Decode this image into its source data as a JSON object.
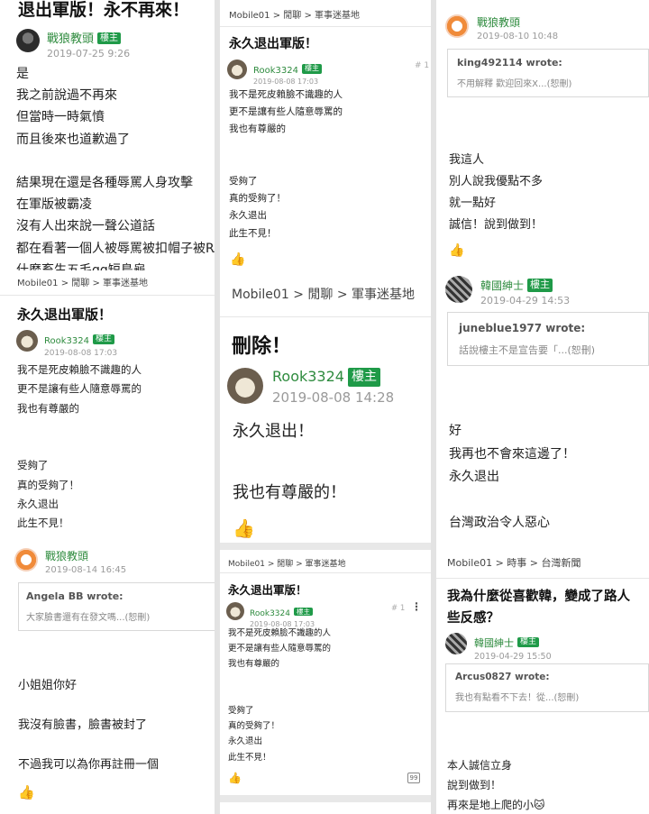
{
  "panels": {
    "p1": {
      "title": "退出軍版！永不再來！",
      "user": "戰狼教頭",
      "badge": "樓主",
      "date": "2019-07-25 9:26",
      "lines": [
        "是",
        "我之前說過不再來",
        "但當時一時氣憤",
        "而且後來也道歉過了",
        "",
        "結果現在還是各種辱罵人身攻擊",
        "在軍版被霸凌",
        "沒有人出來說一聲公道話",
        "都在看著一個人被辱罵被扣帽子被RA",
        "什麼畜生五毛gg短鳥龜。。。"
      ]
    },
    "p2": {
      "crumb": "Mobile01 > 閒聊 > 軍事迷基地",
      "title": "永久退出軍版！",
      "user": "Rook3324",
      "badge": "樓主",
      "date": "2019-08-08 17:03",
      "floor": "# 1",
      "lines": [
        "我不是死皮賴臉不識趣的人",
        "更不是讓有些人隨意辱罵的",
        "我也有尊嚴的",
        "",
        "",
        "受夠了",
        "真的受夠了！",
        "永久退出",
        "此生不見！"
      ]
    },
    "p3": {
      "user": "戰狼教頭",
      "date": "2019-08-10 10:48",
      "quote_author": "king492114 wrote:",
      "quote_text": "不用解釋 歡迎回來X...(恕刪)",
      "lines": [
        "我這人",
        "別人說我優點不多",
        "就一點好",
        "誠信！說到做到！"
      ]
    },
    "p4": {
      "crumb": "Mobile01 > 閒聊 > 軍事迷基地",
      "title": "永久退出軍版！",
      "user": "Rook3324",
      "badge": "樓主",
      "date": "2019-08-08 17:03",
      "lines": [
        "我不是死皮賴臉不識趣的人",
        "更不是讓有些人隨意辱罵的",
        "我也有尊嚴的",
        "",
        "",
        "受夠了",
        "真的受夠了！",
        "永久退出",
        "此生不見！"
      ]
    },
    "p5": {
      "crumb": "Mobile01 > 閒聊 > 軍事迷基地",
      "title": "刪除！",
      "user": "Rook3324",
      "badge": "樓主",
      "date": "2019-08-08 14:28",
      "lines": [
        "永久退出！",
        "",
        "我也有尊嚴的！"
      ]
    },
    "p6": {
      "user": "韓國紳士",
      "badge": "樓主",
      "date": "2019-04-29 14:53",
      "quote_author": "juneblue1977 wrote:",
      "quote_text": "話說樓主不是宣告要「...(恕刪)",
      "lines": [
        "好",
        "我再也不會來這邊了！",
        "永久退出",
        "",
        "台灣政治令人惡心"
      ]
    },
    "p7": {
      "user": "戰狼教頭",
      "date": "2019-08-14 16:45",
      "quote_author": "Angela BB wrote:",
      "quote_text": "大家臉書還有在發文嗎...(恕刪)",
      "lines": [
        "小姐姐你好",
        "",
        "我沒有臉書，臉書被封了",
        "",
        "不過我可以為你再註冊一個"
      ]
    },
    "p8": {
      "crumb": "Mobile01 > 閒聊 > 軍事迷基地",
      "title": "永久退出軍版！",
      "user": "Rook3324",
      "badge": "樓主",
      "date": "2019-08-08 17:03",
      "floor": "# 1",
      "lines": [
        "我不是死皮賴臉不識趣的人",
        "更不是讓有些人隨意辱罵的",
        "我也有尊嚴的",
        "",
        "",
        "受夠了",
        "真的受夠了！",
        "永久退出",
        "此生不見！"
      ]
    },
    "p9": {
      "crumb": "Mobile01 > 時事 > 台灣新聞",
      "title_line1": "我為什麼從喜歡韓，變成了路人",
      "title_line2": "些反感？",
      "user": "韓國紳士",
      "badge": "樓主",
      "date": "2019-04-29 15:50",
      "quote_author": "Arcus0827 wrote:",
      "quote_text": "我也有點看不下去！從...(恕刪)",
      "lines": [
        "本人誠信立身",
        "說到做到！",
        "再來是地上爬的小🐱"
      ]
    }
  },
  "colors": {
    "brand_green": "#1f9a48",
    "username_green": "#2e8b3e"
  },
  "icons": {
    "like": "thumbs-up-icon",
    "reply": "reply-icon",
    "more": "kebab-menu-icon"
  }
}
